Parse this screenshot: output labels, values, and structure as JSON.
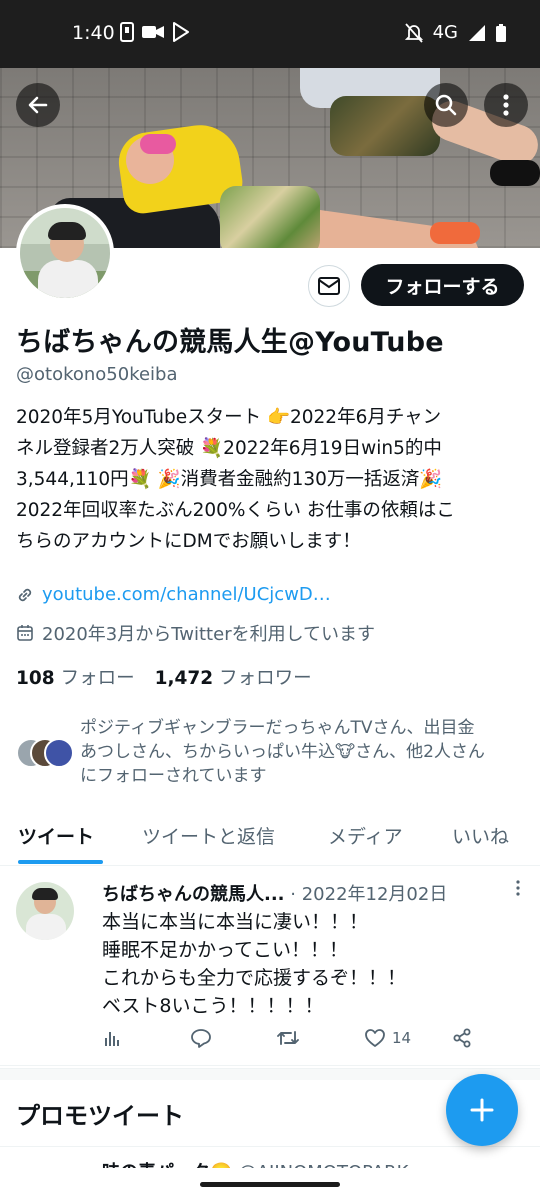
{
  "status_bar": {
    "time": "1:40",
    "network": "4G"
  },
  "profile": {
    "display_name": "ちばちゃんの競馬人生@YouTube",
    "handle": "@otokono50keiba",
    "follow_label": "フォローする",
    "bio_lines": [
      "2020年5月YouTubeスタート 👉2022年6月チャン",
      "ネル登録者2万人突破 💐2022年6月19日win5的中",
      "3,544,110円💐 🎉消費者金融約130万一括返済🎉",
      "2022年回収率たぶん200%くらい お仕事の依頼はこ",
      "ちらのアカウントにDMでお願いします！"
    ],
    "link": "youtube.com/channel/UCjcwD…",
    "joined": "2020年3月からTwitterを利用しています",
    "following_count": "108",
    "following_label": "フォロー",
    "followers_count": "1,472",
    "followers_label": "フォロワー",
    "followed_by_lines": [
      "ポジティブギャンブラーだっちゃんTVさん、出目金",
      "あつしさん、ちからいっぱい牛込🐮さん、他2人さん",
      "にフォローされています"
    ]
  },
  "tabs": [
    {
      "label": "ツイート",
      "active": true
    },
    {
      "label": "ツイートと返信",
      "active": false
    },
    {
      "label": "メディア",
      "active": false
    },
    {
      "label": "いいね",
      "active": false
    }
  ],
  "tweet": {
    "author": "ちばちゃんの競馬人...",
    "separator": "·",
    "date": "2022年12月02日",
    "body_lines": [
      "本当に本当に本当に凄い！！！",
      "睡眠不足かかってこい！！！",
      "これからも全力で応援するぞ！！！",
      "ベスト8いこう！！！！！"
    ],
    "like_count": "14"
  },
  "promo": {
    "title": "プロモツイート",
    "next_name": "味の素パーク🙂",
    "next_handle": "@AJINOMOTOPARK"
  },
  "colors": {
    "accent": "#1d9bf0",
    "text": "#0f1419",
    "muted": "#536471",
    "follow_button": "#0f1419"
  }
}
